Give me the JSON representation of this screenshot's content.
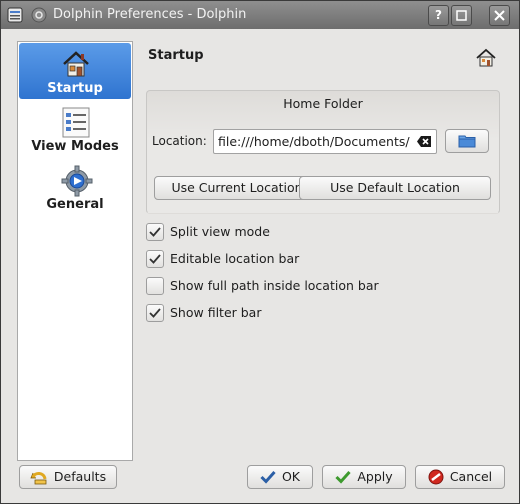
{
  "window": {
    "title": "Dolphin Preferences - Dolphin"
  },
  "titlebar": {
    "help_label": "?"
  },
  "sidebar": {
    "items": [
      {
        "label": "Startup"
      },
      {
        "label": "View Modes"
      },
      {
        "label": "General"
      }
    ]
  },
  "page": {
    "title": "Startup"
  },
  "home_folder": {
    "title": "Home Folder",
    "location_label": "Location:",
    "location_value": "file:///home/dboth/Documents/",
    "use_current_label": "Use Current Location",
    "use_default_label": "Use Default Location"
  },
  "options": [
    {
      "label": "Split view mode",
      "checked": true
    },
    {
      "label": "Editable location bar",
      "checked": true
    },
    {
      "label": "Show full path inside location bar",
      "checked": false
    },
    {
      "label": "Show filter bar",
      "checked": true
    }
  ],
  "footer": {
    "defaults_label": "Defaults",
    "ok_label": "OK",
    "apply_label": "Apply",
    "cancel_label": "Cancel"
  }
}
